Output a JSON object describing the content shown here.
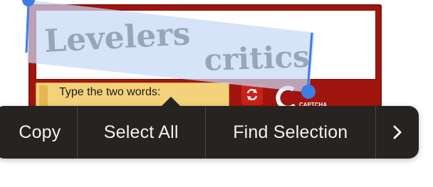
{
  "captcha": {
    "word_one": "Levelers",
    "word_two": "critics",
    "prompt_label": "Type the two words:",
    "logo_text": "CAPTCHA"
  },
  "menu": {
    "items": [
      {
        "label": "Copy"
      },
      {
        "label": "Select All"
      },
      {
        "label": "Find Selection"
      }
    ],
    "more_icon": "chevron-right-icon"
  },
  "colors": {
    "captcha_frame": "#a0160e",
    "prompt_background": "#f3d27b",
    "selection_fill": "#c7d8f7",
    "selection_handle": "#3d7de6",
    "menu_background": "#262320",
    "menu_text": "#f2f2f2"
  }
}
